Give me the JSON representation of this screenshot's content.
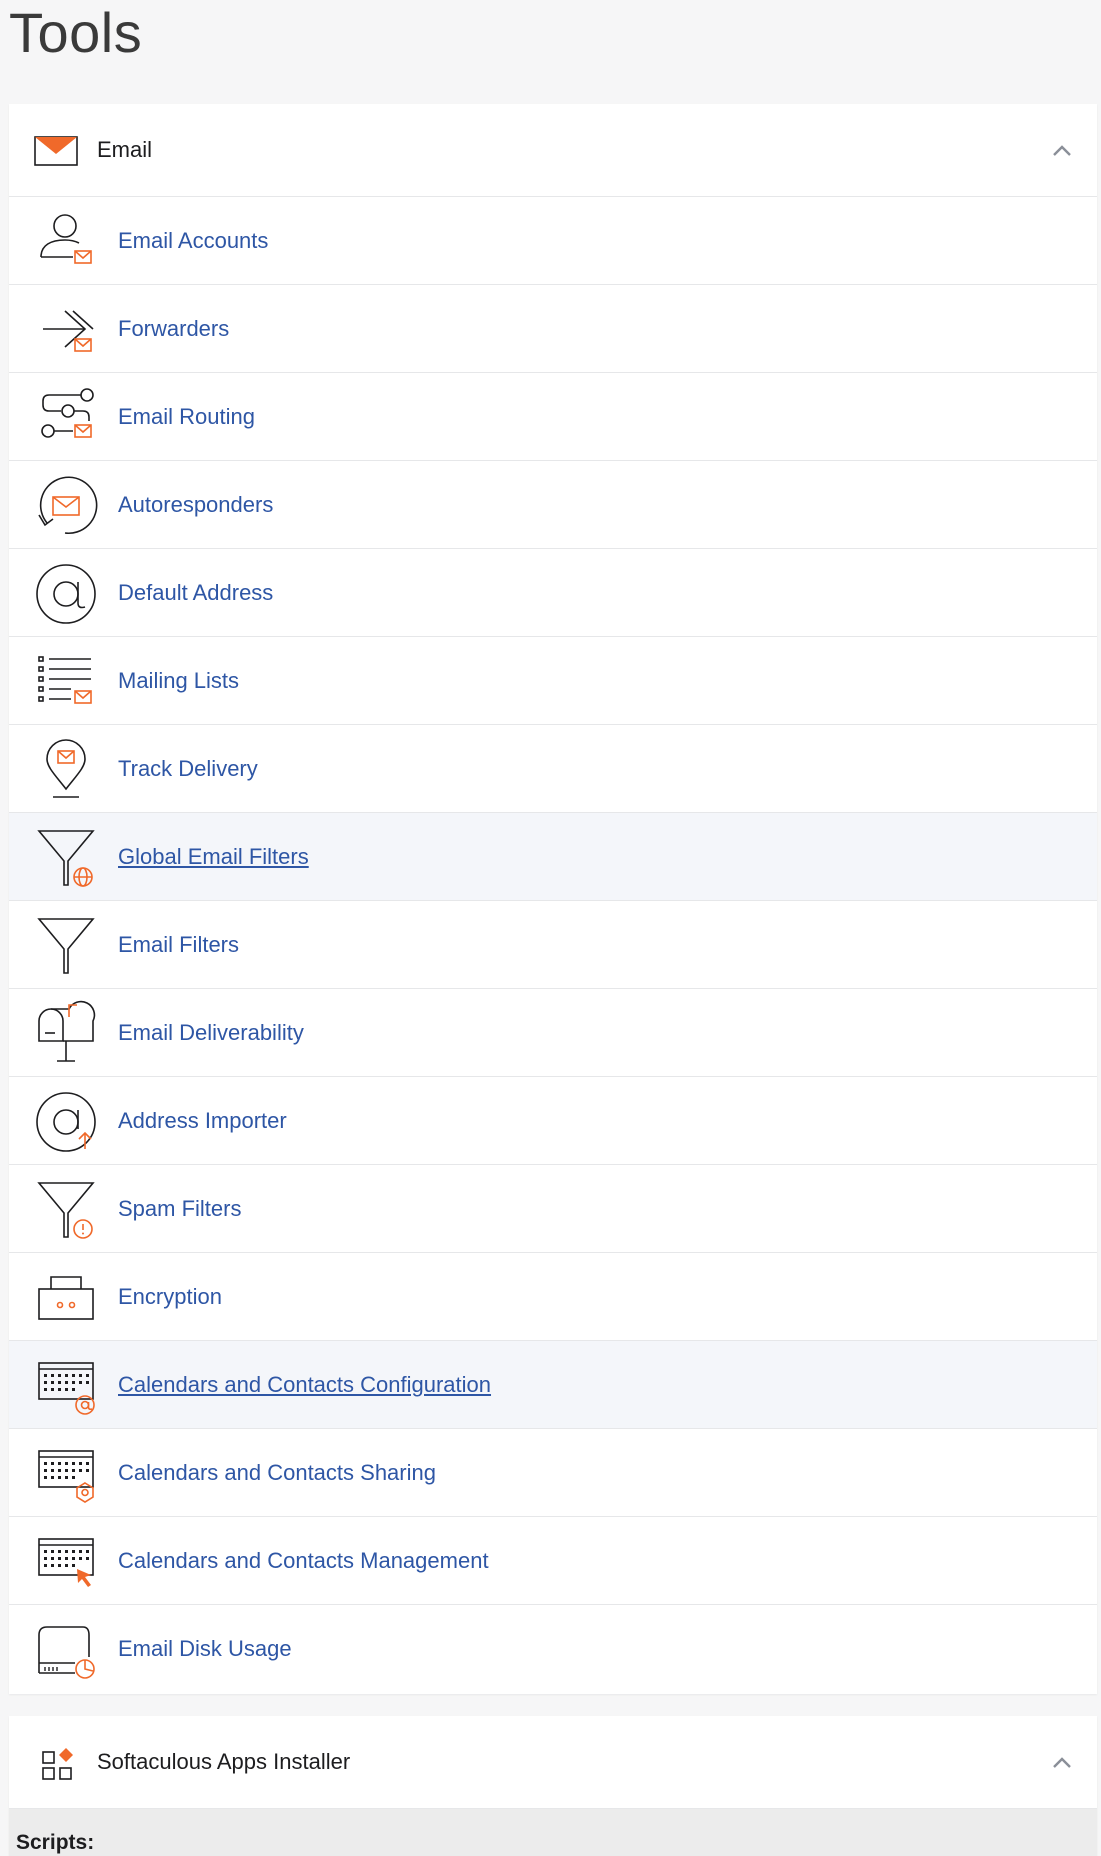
{
  "page": {
    "title": "Tools"
  },
  "email_section": {
    "title": "Email",
    "icon": "envelope-icon",
    "items": [
      {
        "label": "Email Accounts",
        "icon": "email-accounts-icon"
      },
      {
        "label": "Forwarders",
        "icon": "forwarders-icon"
      },
      {
        "label": "Email Routing",
        "icon": "email-routing-icon"
      },
      {
        "label": "Autoresponders",
        "icon": "autoresponders-icon"
      },
      {
        "label": "Default Address",
        "icon": "at-sign-icon"
      },
      {
        "label": "Mailing Lists",
        "icon": "mailing-lists-icon"
      },
      {
        "label": "Track Delivery",
        "icon": "location-pin-icon"
      },
      {
        "label": "Global Email Filters",
        "icon": "funnel-globe-icon"
      },
      {
        "label": "Email Filters",
        "icon": "funnel-icon"
      },
      {
        "label": "Email Deliverability",
        "icon": "mailbox-icon"
      },
      {
        "label": "Address Importer",
        "icon": "at-sign-upload-icon"
      },
      {
        "label": "Spam Filters",
        "icon": "funnel-warning-icon"
      },
      {
        "label": "Encryption",
        "icon": "encryption-icon"
      },
      {
        "label": "Calendars and Contacts Configuration",
        "icon": "calendar-at-icon"
      },
      {
        "label": "Calendars and Contacts Sharing",
        "icon": "calendar-gear-icon"
      },
      {
        "label": "Calendars and Contacts Management",
        "icon": "calendar-cursor-icon"
      },
      {
        "label": "Email Disk Usage",
        "icon": "disk-usage-icon"
      }
    ]
  },
  "softaculous_section": {
    "title": "Softaculous Apps Installer",
    "icon": "apps-grid-icon",
    "subheading": "Scripts:"
  },
  "colors": {
    "accent": "#f0692a",
    "link": "#2e56a5",
    "hover_row": "#f4f6fa"
  }
}
